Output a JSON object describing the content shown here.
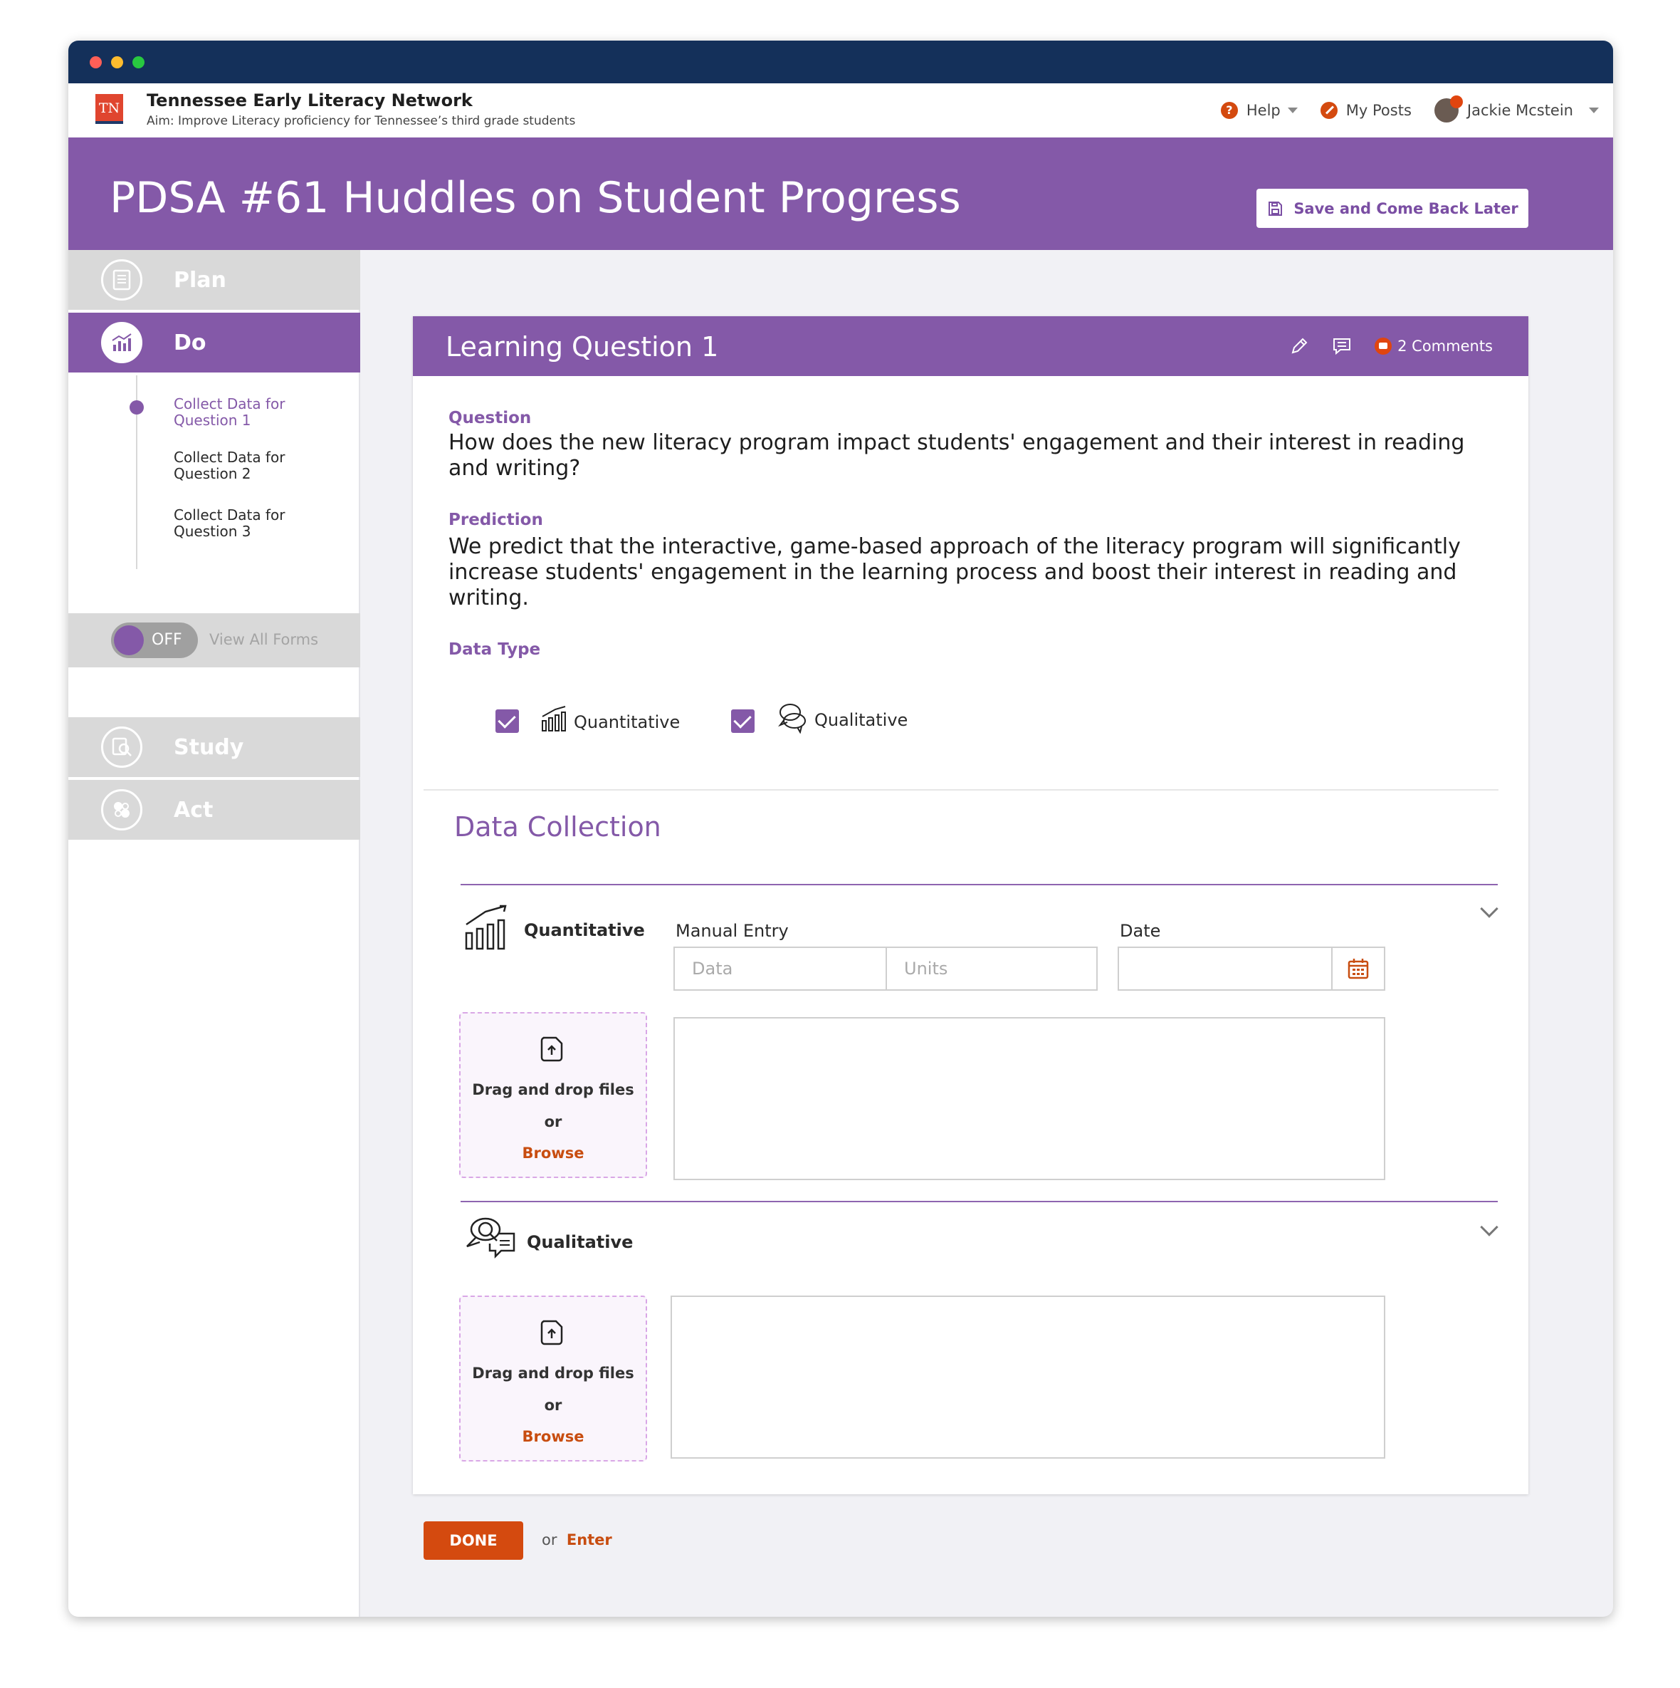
{
  "org": {
    "logo_text": "TN",
    "name": "Tennessee Early Literacy Network",
    "aim": "Aim: Improve Literacy proficiency for Tennessee’s third grade students"
  },
  "nav": {
    "help": "Help",
    "posts": "My Posts",
    "user": "Jackie Mcstein"
  },
  "page": {
    "title": "PDSA #61 Huddles on Student Progress",
    "save_label": "Save and Come Back Later"
  },
  "sidebar": {
    "phases": {
      "plan": "Plan",
      "do": "Do",
      "study": "Study",
      "act": "Act"
    },
    "steps": [
      "Collect Data for Question 1",
      "Collect Data for Question 2",
      "Collect Data for Question 3"
    ],
    "toggle_state": "OFF",
    "toggle_label": "View All Forms"
  },
  "card": {
    "title": "Learning Question 1",
    "comments": "2 Comments",
    "question_label": "Question",
    "question_text": "How does the new literacy program impact students' engagement and their interest in reading and writing?",
    "prediction_label": "Prediction",
    "prediction_text": "We predict that the interactive, game-based approach of the literacy program will significantly increase students' engagement in the learning process and boost their interest in reading and writing.",
    "data_type_label": "Data Type",
    "data_types": [
      "Quantitative",
      "Qualitative"
    ],
    "section_title": "Data Collection",
    "quantitative": {
      "title": "Quantitative",
      "manual_entry_label": "Manual Entry",
      "data_placeholder": "Data",
      "units_placeholder": "Units",
      "date_label": "Date"
    },
    "qualitative": {
      "title": "Qualitative"
    },
    "dropzone": {
      "text": "Drag and drop files",
      "or": "or",
      "browse": "Browse"
    }
  },
  "footer": {
    "done": "DONE",
    "or": "or",
    "enter": "Enter"
  },
  "colors": {
    "brand_purple": "#8459a8",
    "accent_orange": "#d44a0f",
    "titlebar_navy": "#14305a"
  }
}
